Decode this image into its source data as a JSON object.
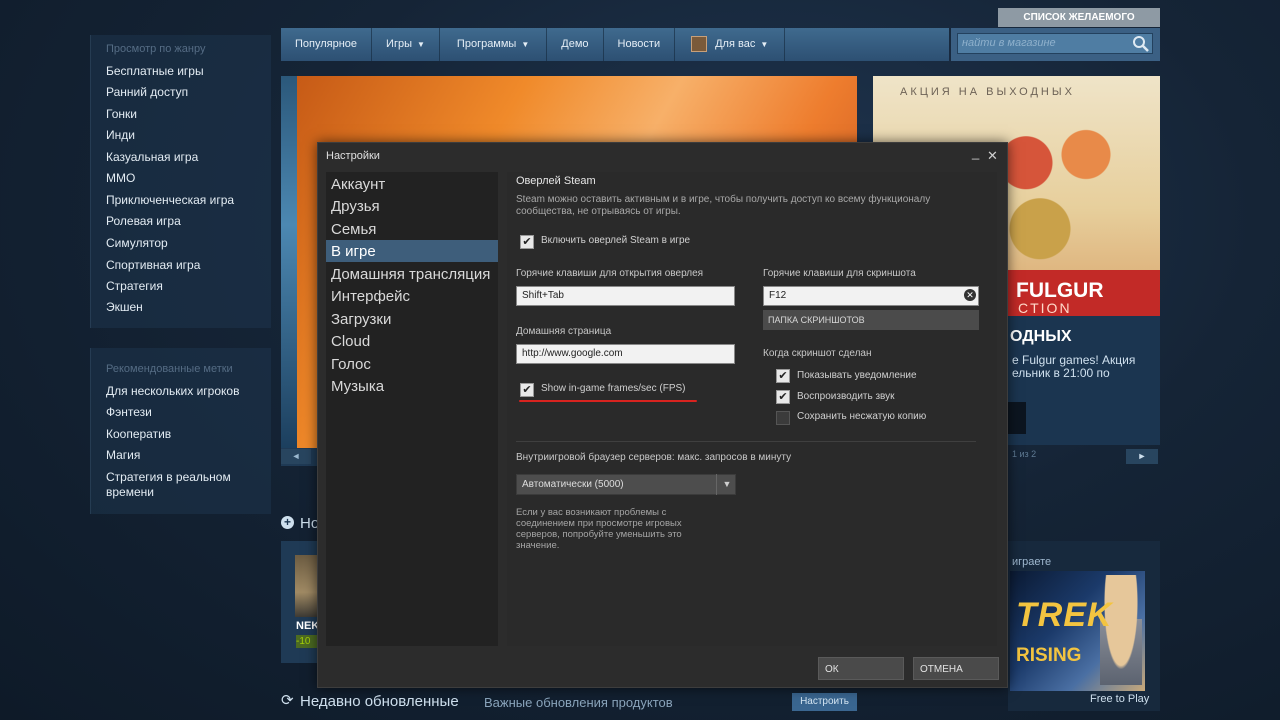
{
  "store": {
    "wishlist_label": "СПИСОК ЖЕЛАЕМОГО",
    "nav": [
      {
        "label": "Популярное",
        "caret": false
      },
      {
        "label": "Игры",
        "caret": true
      },
      {
        "label": "Программы",
        "caret": true
      },
      {
        "label": "Демо",
        "caret": false
      },
      {
        "label": "Новости",
        "caret": false
      },
      {
        "label": "Для вас",
        "caret": true
      }
    ],
    "search_placeholder": "найти в магазине",
    "sidebar_genre_header": "Просмотр по жанру",
    "sidebar_genres": [
      "Бесплатные игры",
      "Ранний доступ",
      "Гонки",
      "Инди",
      "Казуальная игра",
      "MMO",
      "Приключенческая игра",
      "Ролевая игра",
      "Симулятор",
      "Спортивная игра",
      "Стратегия",
      "Экшен"
    ],
    "sidebar_tags_header": "Рекомендованные метки",
    "sidebar_tags": [
      "Для нескольких игроков",
      "Фэнтези",
      "Кооператив",
      "Магия",
      "Стратегия в реальном",
      "времени"
    ],
    "promo_top": "АКЦИЯ НА ВЫХОДНЫХ",
    "promo_red_title": "FULGUR",
    "promo_red_sub": "CTION",
    "promo_heading": "ОДНЫХ",
    "promo_line1": "e Fulgur games! Акция",
    "promo_line2": "ельник в 21:00 по",
    "promo_pager": "1 из 2",
    "new_section_title": "Но",
    "lower_game_name": "NEK",
    "lower_discount": "-10",
    "playing_label": "играете",
    "trek_title": "TREK",
    "trek_rising": "RISING",
    "free_to_play": "Free to Play",
    "updated_title": "Недавно обновленные",
    "updated_subtitle": "Важные обновления продуктов",
    "customize_button": "Настроить",
    "arrow_left": "◄",
    "arrow_right": "►"
  },
  "dialog": {
    "title": "Настройки",
    "nav": [
      "Аккаунт",
      "Друзья",
      "Семья",
      "В игре",
      "Домашняя трансляция",
      "Интерфейс",
      "Загрузки",
      "Cloud",
      "Голос",
      "Музыка"
    ],
    "selected_nav": "В игре",
    "overlay_heading": "Оверлей Steam",
    "overlay_desc_line1": "Steam можно оставить активным и в игре, чтобы получить доступ ко всему функционалу",
    "overlay_desc_line2": "сообщества, не отрываясь от игры.",
    "enable_overlay_label": "Включить оверлей Steam в игре",
    "enable_overlay_checked": true,
    "overlay_hotkey_label": "Горячие клавиши для открытия оверлея",
    "overlay_hotkey_value": "Shift+Tab",
    "homepage_label": "Домашняя страница",
    "homepage_value": "http://www.google.com",
    "fps_label": "Show in-game frames/sec (FPS)",
    "fps_checked": true,
    "screenshot_hotkey_label": "Горячие клавиши для скриншота",
    "screenshot_hotkey_value": "F12",
    "screenshot_folder_button": "ПАПКА СКРИНШОТОВ",
    "when_screenshot_label": "Когда скриншот сделан",
    "show_notification_label": "Показывать уведомление",
    "show_notification_checked": true,
    "play_sound_label": "Воспроизводить звук",
    "play_sound_checked": true,
    "save_uncompressed_label": "Сохранить несжатую копию",
    "save_uncompressed_checked": false,
    "server_browser_label": "Внутриигровой браузер серверов: макс. запросов в минуту",
    "server_browser_value": "Автоматически (5000)",
    "help_lines": [
      "Если у вас возникают проблемы с",
      "соединением при просмотре игровых",
      "серверов, попробуйте уменьшить это",
      "значение."
    ],
    "ok_button": "ОК",
    "cancel_button": "ОТМЕНА"
  }
}
